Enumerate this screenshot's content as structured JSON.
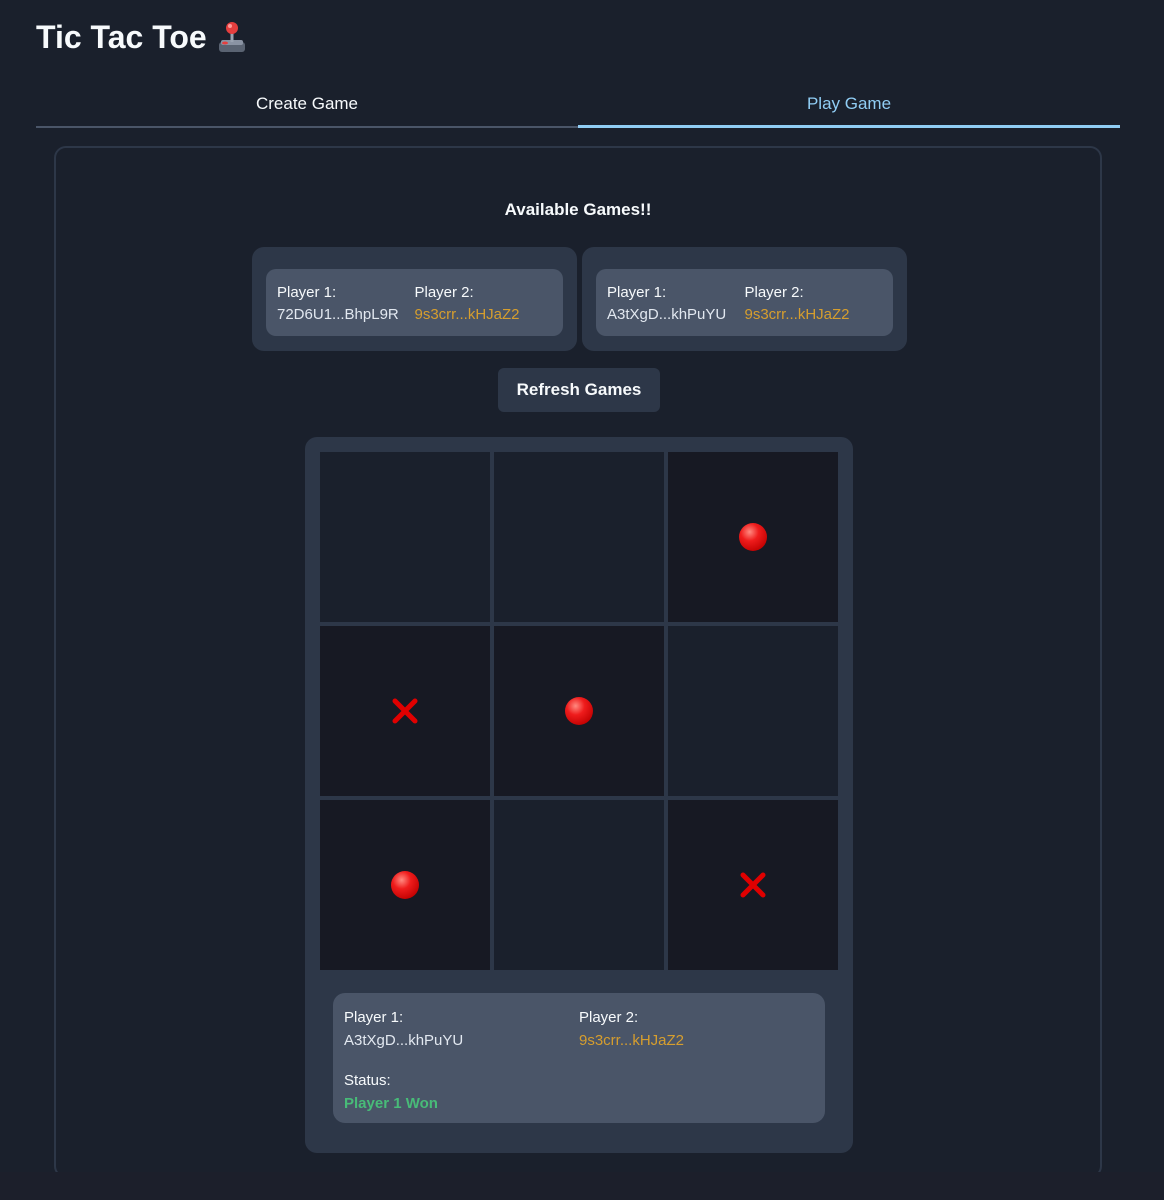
{
  "app": {
    "title": "Tic Tac Toe",
    "title_icon": "joystick-icon"
  },
  "tabs": [
    {
      "label": "Create Game",
      "active": false
    },
    {
      "label": "Play Game",
      "active": true
    }
  ],
  "available_games": {
    "heading": "Available Games!!",
    "games": [
      {
        "player1_label": "Player 1:",
        "player1": "72D6U1...BhpL9R",
        "player2_label": "Player 2:",
        "player2": "9s3crr...kHJaZ2"
      },
      {
        "player1_label": "Player 1:",
        "player1": "A3tXgD...khPuYU",
        "player2_label": "Player 2:",
        "player2": "9s3crr...kHJaZ2"
      }
    ],
    "refresh_label": "Refresh Games"
  },
  "board": {
    "cells": [
      "",
      "",
      "O",
      "X",
      "O",
      "",
      "O",
      "",
      "X"
    ],
    "mark_icons": {
      "O": "red-circle-icon",
      "X": "red-cross-icon"
    }
  },
  "game_status": {
    "player1_label": "Player 1:",
    "player1": "A3tXgD...khPuYU",
    "player2_label": "Player 2:",
    "player2": "9s3crr...kHJaZ2",
    "status_label": "Status:",
    "status": "Player 1 Won"
  },
  "colors": {
    "background": "#1a202c",
    "accent": "#90cdf4",
    "player2_address": "#d69e2e",
    "status_won": "#48bb78",
    "mark": "#e00000"
  }
}
